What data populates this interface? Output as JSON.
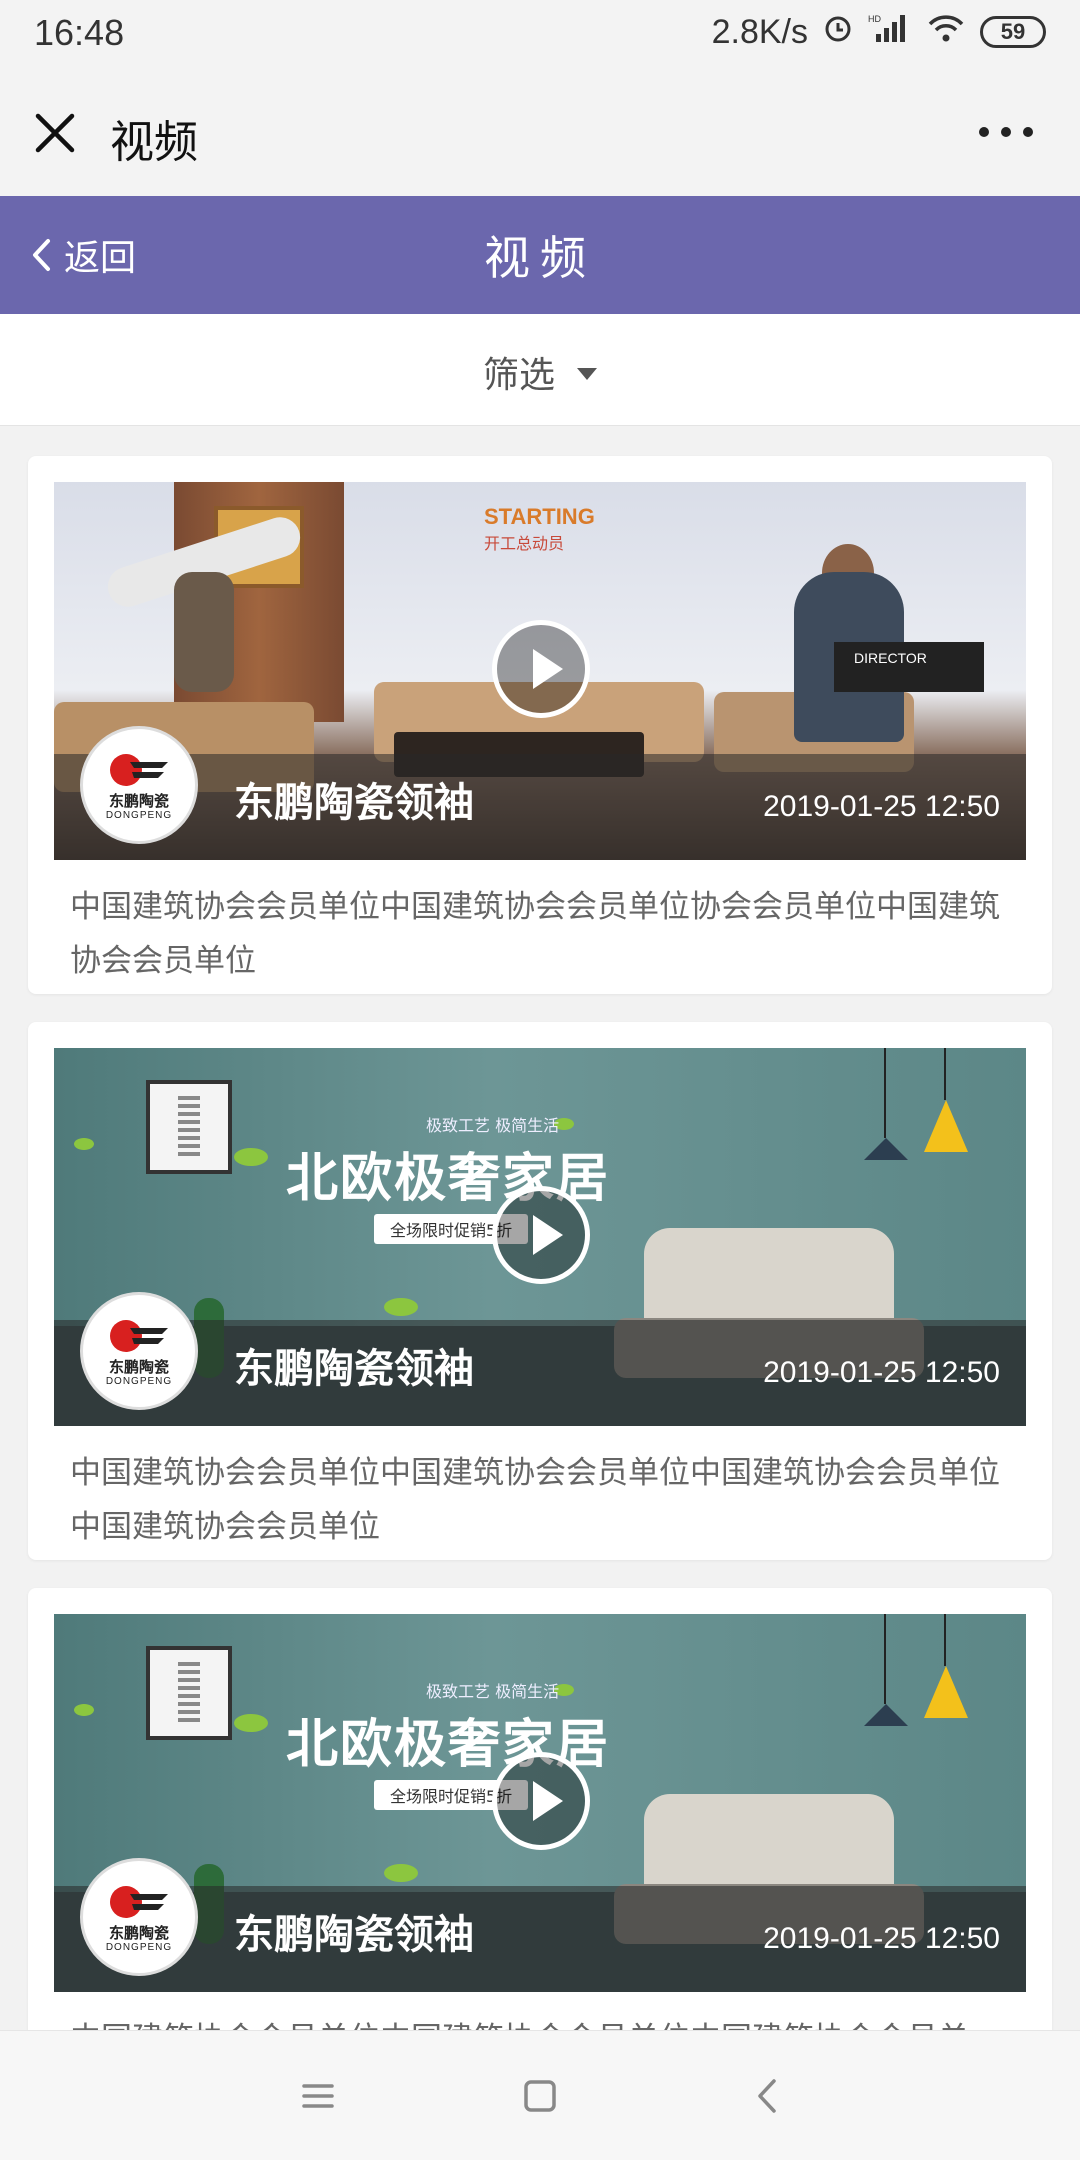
{
  "status_bar": {
    "time": "16:48",
    "net_speed": "2.8K/s",
    "battery": "59"
  },
  "wechat_bar": {
    "title": "视频"
  },
  "header": {
    "back_label": "返回",
    "title": "视频"
  },
  "filter": {
    "label": "筛选"
  },
  "cards": [
    {
      "author": "东鹏陶瓷领袖",
      "date": "2019-01-25 12:50",
      "description": "中国建筑协会会员单位中国建筑协会会员单位协会会员单位中国建筑协会会员单位",
      "logo_cn": "东鹏陶瓷",
      "logo_en": "DONGPENG",
      "banner": {
        "headline_en": "STARTING",
        "headline_cn": "开工总动员",
        "chair_label": "DIRECTOR"
      }
    },
    {
      "author": "东鹏陶瓷领袖",
      "date": "2019-01-25 12:50",
      "description": "中国建筑协会会员单位中国建筑协会会员单位中国建筑协会会员单位中国建筑协会会员单位",
      "logo_cn": "东鹏陶瓷",
      "logo_en": "DONGPENG",
      "banner": {
        "tagline": "极致工艺 极简生活",
        "title": "北欧极奢家居",
        "sub": "全场限时促销5折"
      }
    },
    {
      "author": "东鹏陶瓷领袖",
      "date": "2019-01-25 12:50",
      "description": "中国建筑协会会员单位中国建筑协会会员单位中国建筑协会会员单",
      "logo_cn": "东鹏陶瓷",
      "logo_en": "DONGPENG",
      "banner": {
        "tagline": "极致工艺 极简生活",
        "title": "北欧极奢家居",
        "sub": "全场限时促销5折"
      }
    }
  ],
  "colors": {
    "header_bg": "#6b67ad",
    "page_bg": "#f2f2f2"
  }
}
